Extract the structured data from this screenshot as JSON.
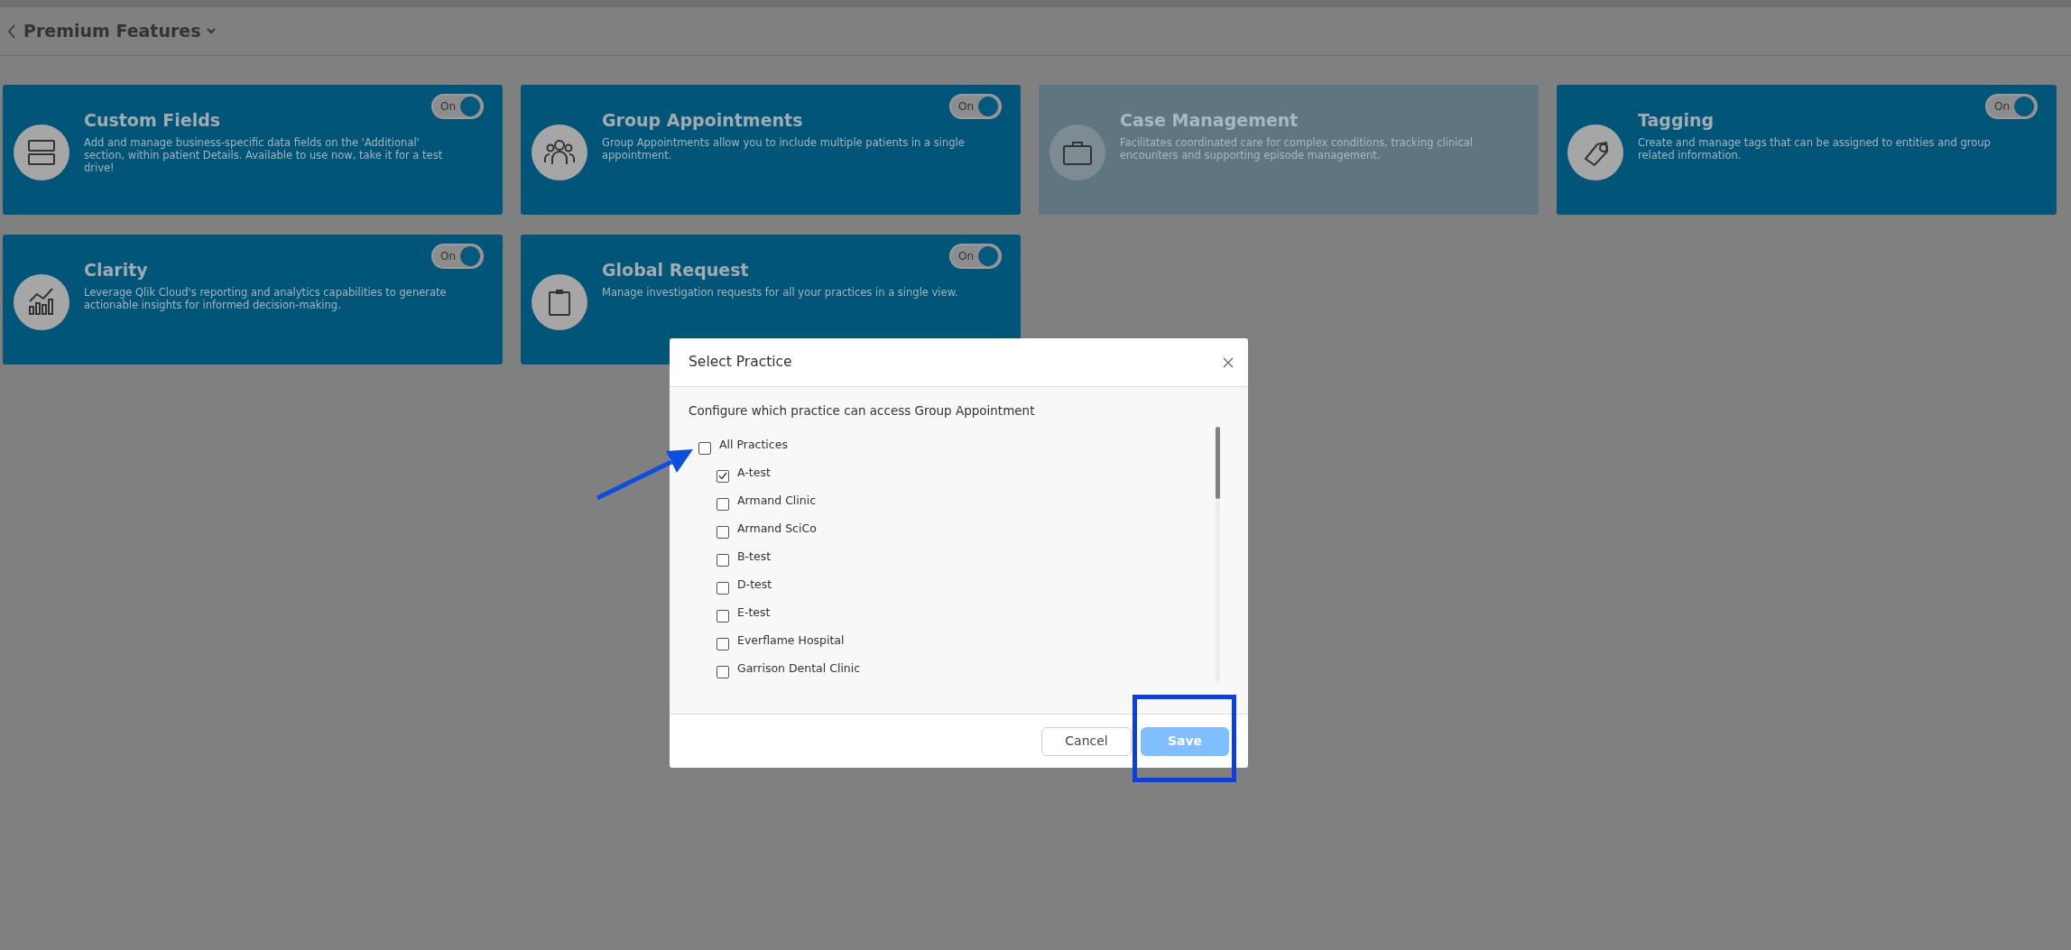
{
  "header": {
    "title": "Premium Features"
  },
  "features": [
    {
      "title": "Custom Fields",
      "description": "Add and manage business-specific data fields on the 'Additional' section, within patient Details. Available to use now, take it for a test drive!",
      "enabled": true,
      "toggle": {
        "label": "On",
        "on": true
      }
    },
    {
      "title": "Group Appointments",
      "description": "Group Appointments allow you to include multiple patients in a single appointment.",
      "enabled": true,
      "toggle": {
        "label": "On",
        "on": true
      }
    },
    {
      "title": "Case Management",
      "description": "Facilitates coordinated care for complex conditions, tracking clinical encounters and supporting episode management.",
      "enabled": false
    },
    {
      "title": "Tagging",
      "description": "Create and manage tags that can be assigned to entities and group related information.",
      "enabled": true,
      "toggle": {
        "label": "On",
        "on": true
      }
    },
    {
      "title": "Clarity",
      "description": "Leverage Qlik Cloud's reporting and analytics capabilities to generate actionable insights for informed decision-making.",
      "enabled": true,
      "toggle": {
        "label": "On",
        "on": true
      }
    },
    {
      "title": "Global Request",
      "description": "Manage investigation requests for all your practices in a single view.",
      "enabled": true,
      "toggle": {
        "label": "On",
        "on": true
      }
    }
  ],
  "dialog": {
    "title": "Select Practice",
    "message": "Configure which practice can access Group Appointment",
    "practices": [
      {
        "label": "All Practices",
        "checked": false,
        "children": [
          {
            "label": "A-test",
            "checked": true
          },
          {
            "label": "Armand Clinic",
            "checked": false
          },
          {
            "label": "Armand SciCo",
            "checked": false
          },
          {
            "label": "B-test",
            "checked": false
          },
          {
            "label": "D-test",
            "checked": false
          },
          {
            "label": "E-test",
            "checked": false
          },
          {
            "label": "Everflame Hospital",
            "checked": false
          },
          {
            "label": "Garrison Dental Clinic",
            "checked": false
          }
        ]
      }
    ],
    "buttons": [
      {
        "label": "Cancel",
        "kind": "secondary",
        "disabled": false
      },
      {
        "label": "Save",
        "kind": "primary",
        "disabled": true
      }
    ]
  }
}
